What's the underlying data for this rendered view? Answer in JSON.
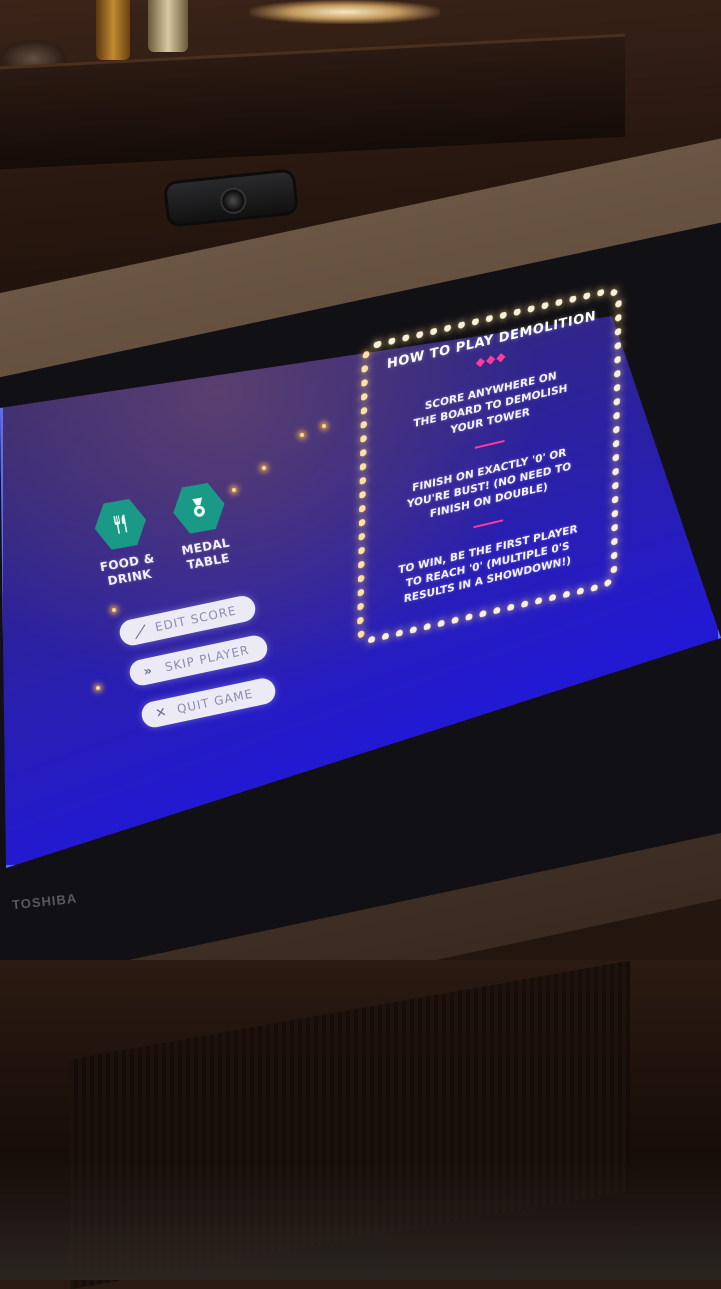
{
  "cabinet": {
    "brand": "TOSHIBA"
  },
  "sidebar": {
    "food_drink_label_line1": "FOOD &",
    "food_drink_label_line2": "DRINK",
    "medal_table_label_line1": "MEDAL",
    "medal_table_label_line2": "TABLE"
  },
  "actions": {
    "edit_score": "EDIT SCORE",
    "skip_player": "SKIP PLAYER",
    "quit_game": "QUIT GAME"
  },
  "how_to_play": {
    "title": "HOW TO PLAY DEMOLITION",
    "divider_glyphs": "◆◆◆",
    "rule1_line1": "SCORE ANYWHERE ON",
    "rule1_line2": "THE BOARD TO DEMOLISH",
    "rule1_line3": "YOUR TOWER",
    "rule2_line1": "FINISH ON EXACTLY '0' OR",
    "rule2_line2": "YOU'RE BUST! (NO NEED TO",
    "rule2_line3": "FINISH ON DOUBLE)",
    "rule3_line1": "TO WIN, BE THE FIRST PLAYER",
    "rule3_line2": "TO REACH '0' (MULTIPLE 0'S",
    "rule3_line3": "RESULTS IN A SHOWDOWN!)"
  },
  "icons": {
    "food_drink": "fork-knife-icon",
    "medal_table": "medal-icon",
    "edit": "pencil-icon",
    "skip": "fast-forward-icon",
    "quit": "close-icon"
  },
  "colors": {
    "screen_blue": "#2219d4",
    "teal": "#1a9a86",
    "accent_pink": "#ff3aa0",
    "pill_bg": "#ecebf5"
  }
}
